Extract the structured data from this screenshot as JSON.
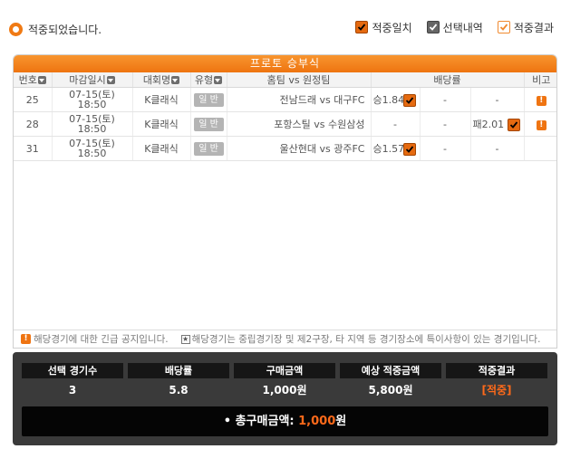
{
  "status": {
    "text": "적중되었습니다."
  },
  "legend": [
    {
      "label": "적중일치",
      "style": "orange"
    },
    {
      "label": "선택내역",
      "style": "gray"
    },
    {
      "label": "적중결과",
      "style": "outline"
    }
  ],
  "panel": {
    "title": "프로토 승부식",
    "headers": {
      "no": "번호",
      "deadline": "마감일시",
      "league": "대회명",
      "type": "유형",
      "teams": "홈팀  vs 원정팀",
      "odds": "배당률",
      "note": "비고"
    },
    "rows": [
      {
        "no": "25",
        "date": "07-15(토)",
        "time": "18:50",
        "league": "K클래식",
        "type": "일 반",
        "teams": "전남드래  vs 대구FC",
        "win": "승1.84",
        "draw": "-",
        "lose": "-",
        "checked": "win",
        "warn": true
      },
      {
        "no": "28",
        "date": "07-15(토)",
        "time": "18:50",
        "league": "K클래식",
        "type": "일 반",
        "teams": "포항스틸  vs 수원삼성",
        "win": "-",
        "draw": "-",
        "lose": "패2.01",
        "checked": "lose",
        "warn": true
      },
      {
        "no": "31",
        "date": "07-15(토)",
        "time": "18:50",
        "league": "K클래식",
        "type": "일 반",
        "teams": "울산현대  vs 광주FC",
        "win": "승1.57",
        "draw": "-",
        "lose": "-",
        "checked": "win",
        "warn": false
      }
    ],
    "note_warn": "해당경기에 대한 긴급 공지입니다.",
    "note_star": "해당경기는 중립경기장 및 제2구장, 타 지역 등 경기장소에 특이사항이 있는 경기입니다.",
    "star_symbol": "★",
    "warn_symbol": "!"
  },
  "summary": {
    "columns": [
      {
        "label": "선택 경기수",
        "value": "3"
      },
      {
        "label": "배당률",
        "value": "5.8"
      },
      {
        "label": "구매금액",
        "value": "1,000원"
      },
      {
        "label": "예상 적중금액",
        "value": "5,800원"
      },
      {
        "label": "적중결과",
        "value": "[적중]"
      }
    ],
    "total_label": "• 총구매금액:",
    "total_amount": "1,000",
    "total_unit": "원"
  },
  "colors": {
    "accent": "#ef7412",
    "dark": "#3a3a3a",
    "result": "#ff6a1a"
  }
}
